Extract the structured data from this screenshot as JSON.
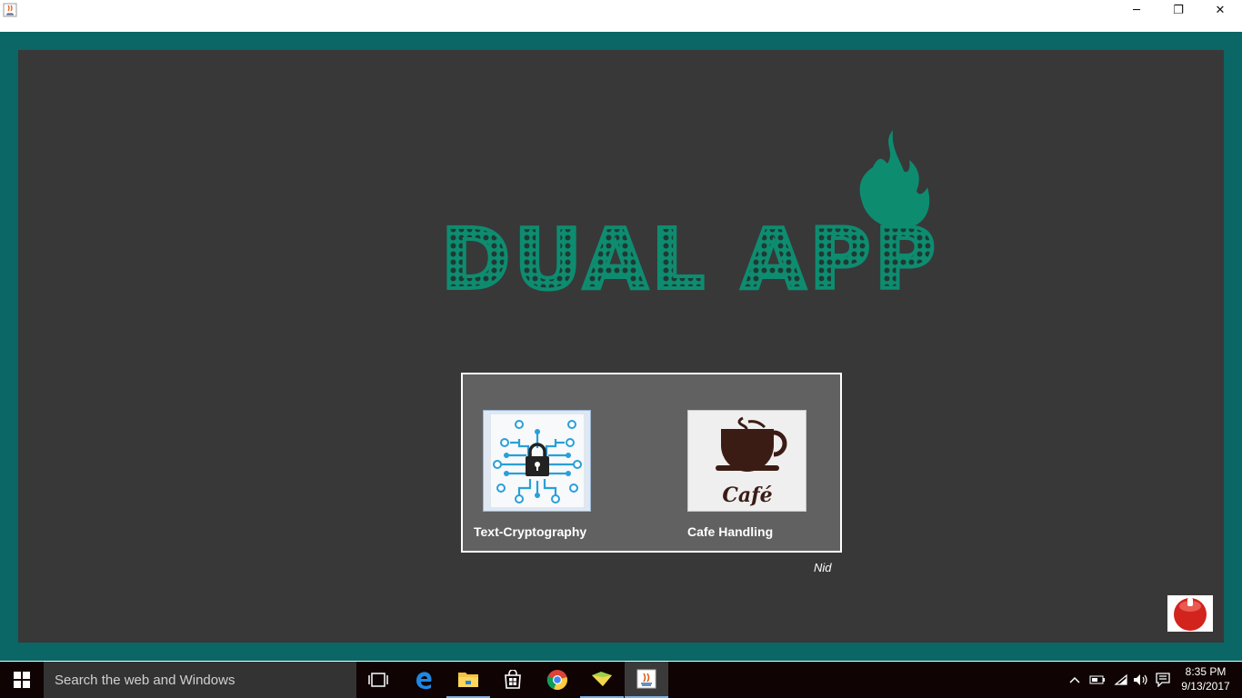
{
  "window": {
    "minimize_glyph": "─",
    "maximize_glyph": "❐",
    "close_glyph": "✕"
  },
  "app": {
    "logo_text": "DUAL APP",
    "modules": [
      {
        "label": "Text-Cryptography",
        "icon": "circuit-lock-icon"
      },
      {
        "label": "Cafe Handling",
        "icon": "coffee-cup-icon",
        "icon_caption": "Café"
      }
    ],
    "signature": "Nid",
    "colors": {
      "frame": "#0b6666",
      "panel": "#383838",
      "accent": "#0e8c70",
      "card": "#616161"
    }
  },
  "taskbar": {
    "search_placeholder": "Search the web and Windows",
    "time": "8:35 PM",
    "date": "9/13/2017",
    "pinned": [
      "task-view-icon",
      "edge-icon",
      "file-explorer-icon",
      "store-icon",
      "chrome-icon",
      "folder-app-icon",
      "java-icon"
    ]
  }
}
